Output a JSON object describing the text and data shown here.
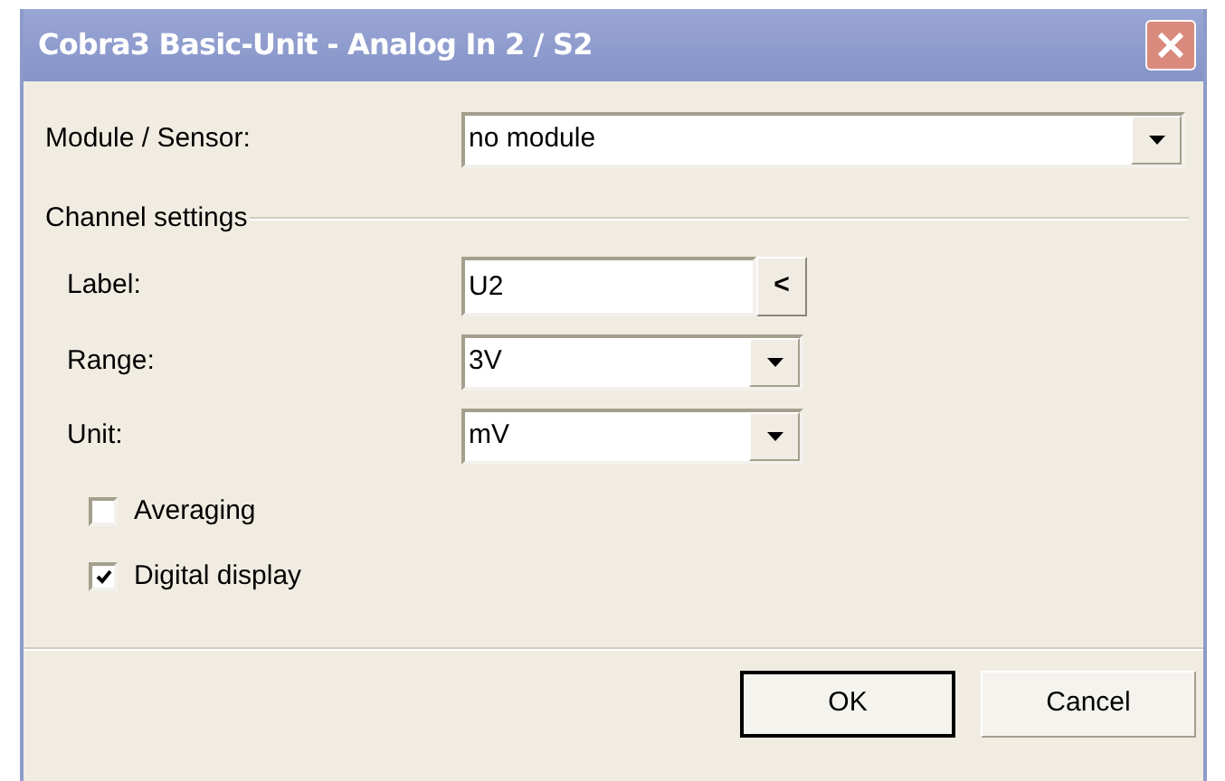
{
  "window": {
    "title": "Cobra3 Basic-Unit - Analog In 2 / S2"
  },
  "module": {
    "label": "Module / Sensor:",
    "value": "no module"
  },
  "channel_settings": {
    "title": "Channel settings",
    "fields": [
      {
        "kind": "text",
        "label": "Label:",
        "value": "U2",
        "button": "<"
      },
      {
        "kind": "combo",
        "label": "Range:",
        "value": "3V"
      },
      {
        "kind": "combo",
        "label": "Unit:",
        "value": "mV"
      }
    ],
    "options": [
      {
        "label": "Averaging",
        "checked": false
      },
      {
        "label": "Digital display",
        "checked": true
      }
    ]
  },
  "buttons": [
    {
      "label": "OK",
      "default": true
    },
    {
      "label": "Cancel",
      "default": false
    }
  ]
}
